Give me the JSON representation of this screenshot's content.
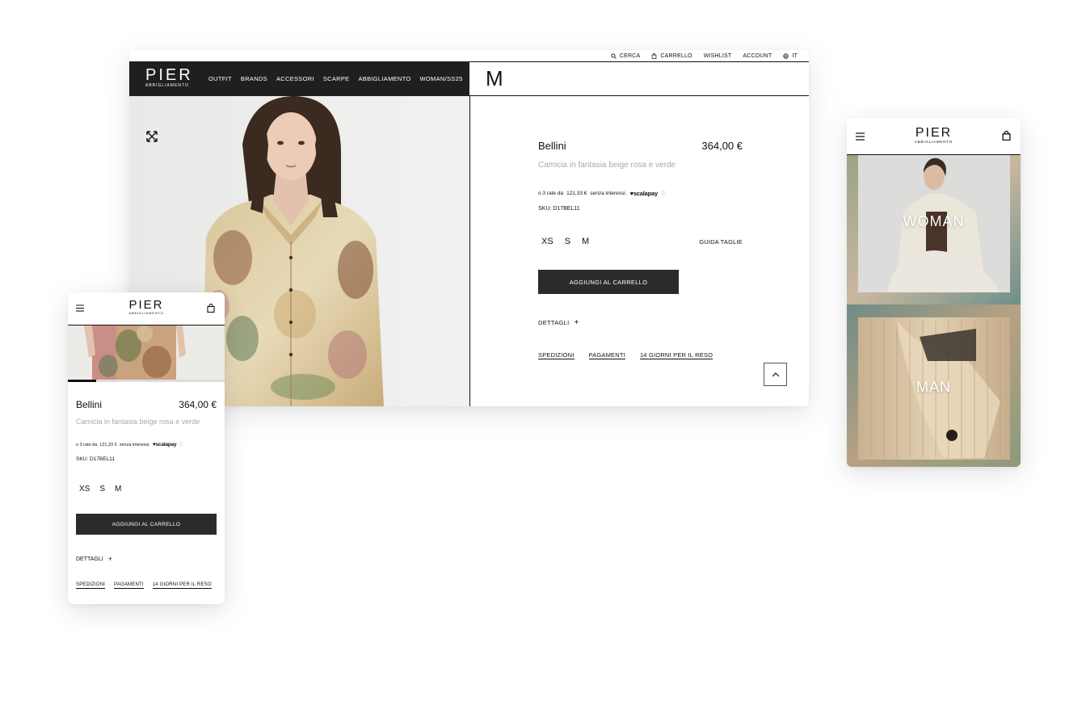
{
  "desktop": {
    "topbar": [
      "CERCA",
      "CARRELLO",
      "WISHLIST",
      "ACCOUNT",
      "IT"
    ],
    "logo": {
      "name": "PIER",
      "tagline": "ABBIGLIAMENTO"
    },
    "nav": [
      "OUTFIT",
      "BRANDS",
      "ACCESSORI",
      "SCARPE",
      "ABBIGLIAMENTO",
      "WOMAN/SS25"
    ],
    "brand_initial": "M"
  },
  "product": {
    "name": "Bellini",
    "price": "364,00 €",
    "description": "Camicia in fantasia beige rosa e verde",
    "installment_text": "o 3 rate da",
    "installment_amount": "121,33 €",
    "installment_suffix": "senza interessi.",
    "installment_provider": "scalapay",
    "sku": "SKU: D17BEL11",
    "sizes": [
      "XS",
      "S",
      "M"
    ],
    "size_guide": "GUIDA TAGLIE",
    "add_to_cart": "AGGIUNGI AL CARRELLO",
    "details": "DETTAGLI",
    "details_icon": "+",
    "links": [
      "SPEDIZIONI",
      "PAGAMENTI",
      "14 GIORNI PER IL RESO"
    ]
  },
  "mobile_home": {
    "categories": [
      "WOMAN",
      "MAN"
    ]
  },
  "gallery": {
    "progress": 0.18
  },
  "colors": {
    "dark": "#1f1f1f",
    "button": "#2b2b2b",
    "muted": "#a8a8a8"
  },
  "icons": [
    "search-icon",
    "bag-icon",
    "globe-icon",
    "expand-icon",
    "hamburger-icon",
    "chevron-up-icon",
    "heart-icon"
  ]
}
